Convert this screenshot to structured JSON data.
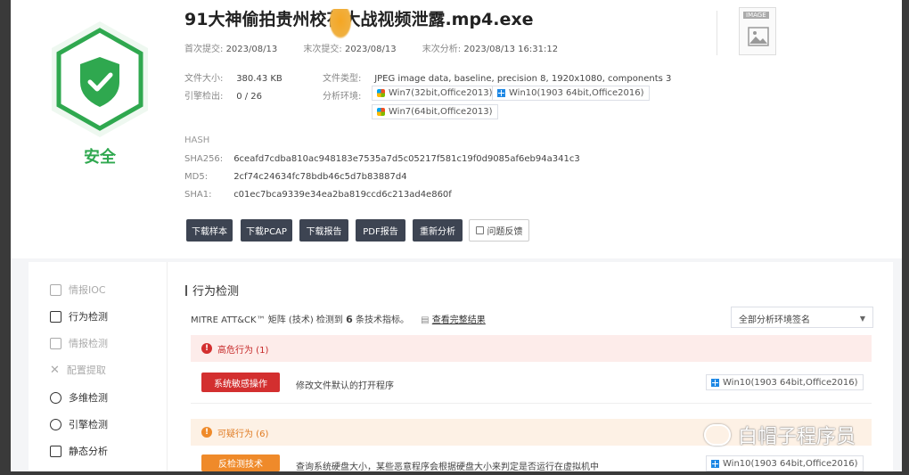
{
  "file": {
    "title": "91大神偷拍贵州校花大战视频泄露.mp4.exe",
    "verdict": "安全"
  },
  "dates": {
    "first_submit_label": "首次提交:",
    "first_submit": "2023/08/13",
    "last_submit_label": "末次提交:",
    "last_submit": "2023/08/13",
    "last_analysis_label": "末次分析:",
    "last_analysis": "2023/08/13 16:31:12"
  },
  "info": {
    "size_label": "文件大小:",
    "size": "380.43 KB",
    "type_label": "文件类型:",
    "type": "JPEG image data, baseline, precision 8, 1920x1080, components 3",
    "engine_label": "引擎检出:",
    "engine": "0 / 26",
    "env_label": "分析环境:",
    "envs": [
      "Win7(32bit,Office2013)",
      "Win10(1903 64bit,Office2016)",
      "Win7(64bit,Office2013)"
    ]
  },
  "hash": {
    "section_label": "HASH",
    "sha256_label": "SHA256:",
    "sha256": "6ceafd7cdba810ac948183e7535a7d5c05217f581c19f0d9085af6eb94a341c3",
    "md5_label": "MD5:",
    "md5": "2cf74c24634fc78bdb46c5d7b83887d4",
    "sha1_label": "SHA1:",
    "sha1": "c01ec7bca9339e34ea2ba819ccd6c213ad4e860f"
  },
  "buttons": [
    "下载样本",
    "下载PCAP",
    "下载报告",
    "PDF报告",
    "重新分析",
    "问题反馈"
  ],
  "thumb_tag": "IMAGE",
  "sidebar": [
    "情报IOC",
    "行为检测",
    "情报检测",
    "配置提取",
    "多维检测",
    "引擎检测",
    "静态分析"
  ],
  "behavior": {
    "section_title": "行为检测",
    "mitre_prefix": "MITRE ATT&CK™ 矩阵 (技术) 检测到",
    "mitre_count": "6",
    "mitre_suffix": "条技术指标。",
    "view_full": "查看完整结果",
    "select_value": "全部分析环境签名",
    "high_risk": "高危行为 (1)",
    "high_row": {
      "tag": "系统敏感操作",
      "desc": "修改文件默认的打开程序",
      "env": "Win10(1903 64bit,Office2016)"
    },
    "suspicious": "可疑行为 (6)",
    "sus_row": {
      "tag": "反检测技术",
      "desc": "查询系统硬盘大小，某些恶意程序会根据硬盘大小来判定是否运行在虚拟机中",
      "env": "Win10(1903 64bit,Office2016)"
    }
  },
  "watermark": "白帽子程序员",
  "colors": {
    "safe_green": "#2fa84f",
    "high_red": "#d32f2f",
    "sus_orange": "#ef8a2a",
    "btn_dark": "#3d4452"
  }
}
